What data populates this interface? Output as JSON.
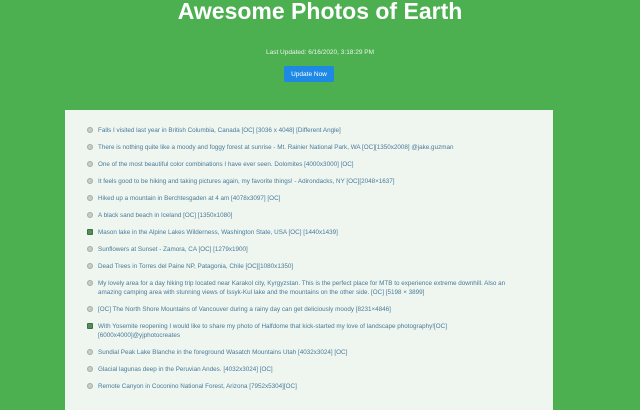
{
  "header": {
    "title": "Awesome Photos of Earth",
    "last_updated": "Last Updated: 6/16/2020, 3:18:29 PM",
    "update_button_label": "Update Now"
  },
  "photos": [
    {
      "text": "Falls I visited last year in British Columbia, Canada [OC] [3036 x 4048] [Different Angle]",
      "icon": "globe-icon"
    },
    {
      "text": "There is nothing quite like a moody and foggy forest at sunrise - Mt. Rainier National Park, WA [OC][1350x2008] @jake.guzman",
      "icon": "globe-icon"
    },
    {
      "text": "One of the most beautiful color combinations I have ever seen. Dolomites [4000x3000] [OC]",
      "icon": "globe-icon"
    },
    {
      "text": "It feels good to be hiking and taking pictures again, my favorite things! - Adirondacks, NY [OC][2048×1637]",
      "icon": "globe-icon"
    },
    {
      "text": "Hiked up a mountain in Berchtesgaden at 4 am [4078x3097] [OC]",
      "icon": "globe-icon"
    },
    {
      "text": "A black sand beach in Iceland [OC] [1350x1080]",
      "icon": "globe-icon"
    },
    {
      "text": "Mason lake in the Alpine Lakes Wilderness, Washington State, USA [OC] [1440x1439]",
      "icon": "image-icon"
    },
    {
      "text": "Sunflowers at Sunset - Zamora, CA [OC] [1279x1900]",
      "icon": "globe-icon"
    },
    {
      "text": "Dead Trees in Torres del Paine NP, Patagonia, Chile [OC][1080x1350]",
      "icon": "globe-icon"
    },
    {
      "text": "My lovely area for a day hiking trip located near Karakol city, Kyrgyzstan. This is the perfect place for MTB to experience extreme downhill. Also an amazing camping area with stunning views of Issyk-Kul lake and the mountains on the other side. [OC] [5198 × 3899]",
      "icon": "globe-icon",
      "wrap": true
    },
    {
      "text": "[OC] The North Shore Mountains of Vancouver during a rainy day can get deliciously moody [8231×4846]",
      "icon": "globe-icon"
    },
    {
      "text": "With Yosemite reopening I would like to share my photo of Halfdome that kick-started my love of landscape photography![OC][6000x4000]@yjphotocreates",
      "icon": "image-icon"
    },
    {
      "text": "Sundial Peak Lake Blanche in the foreground Wasatch Mountains Utah [4032x3024] [OC]",
      "icon": "globe-icon"
    },
    {
      "text": "Glacial lagunas deep in the Peruvian Andes. [4032x3024] [OC]",
      "icon": "globe-icon"
    },
    {
      "text": "Remote Canyon in Coconino National Forest, Arizona [7952x5304][OC]",
      "icon": "globe-icon"
    }
  ]
}
